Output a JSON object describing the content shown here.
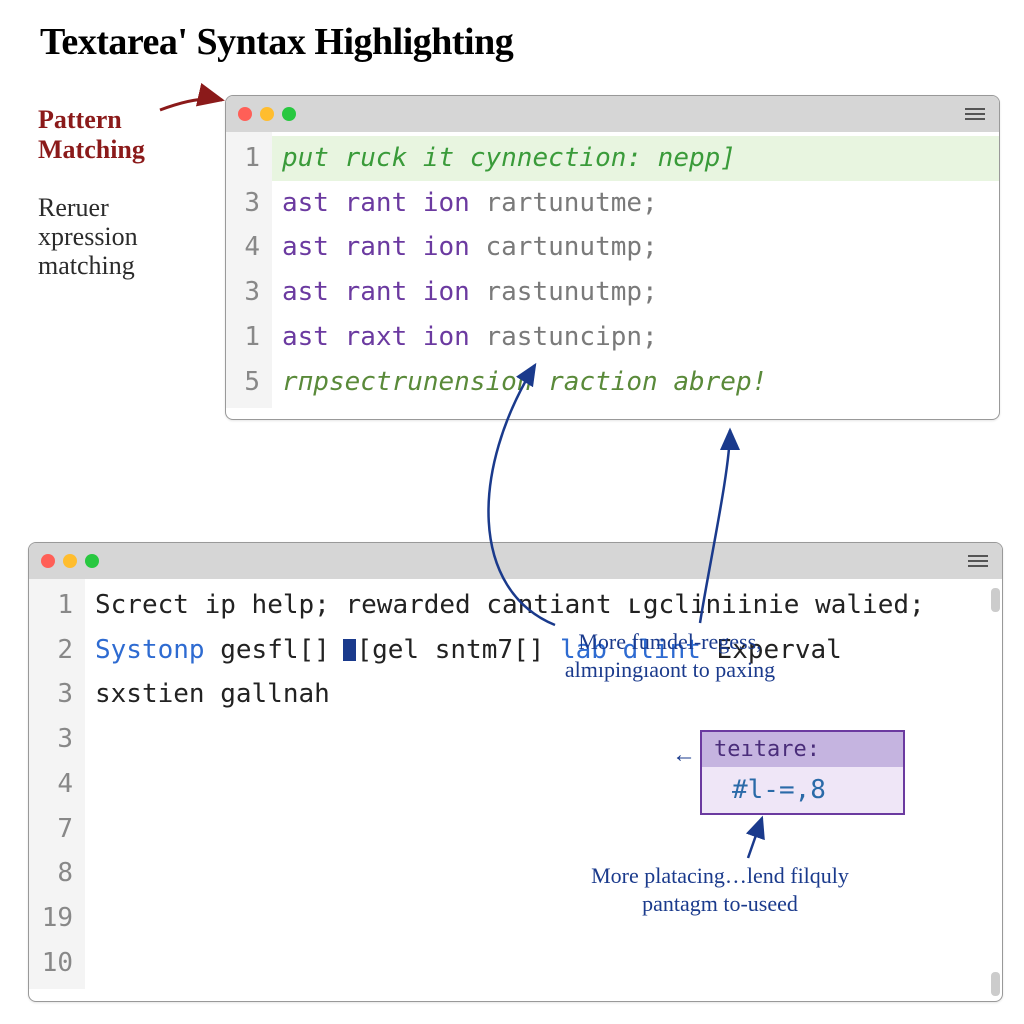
{
  "title": "Textarea' Syntax Highlighting",
  "labels": {
    "patternMatching": "Pattern\nMatching",
    "reruer": "Reruer\nxpression\nmatching"
  },
  "window1": {
    "gutter": [
      "1",
      "3",
      "4",
      "3",
      "1",
      "5"
    ],
    "line1": "put ruck it cynnection: nepp]",
    "line2_a": "ast rant ion",
    "line2_b": " rartunutme;",
    "line3_a": "ast rant ion",
    "line3_b": " cartunutmp;",
    "line4_a": "ast rant ion",
    "line4_b": " rastunutmp;",
    "line5_a": "ast raxt ion",
    "line5_b": " rastuncipn;",
    "line6_a": "rпpsectrunension",
    "line6_b": " raction abrep!"
  },
  "window2": {
    "gutter": [
      "1",
      "2",
      "3",
      "3",
      "4",
      "7",
      "8",
      "19",
      "10"
    ],
    "l1": "Screct ip",
    "l2": "help;",
    "l3": "rewarded cantiant",
    "l4_a": "ʟgcliniinie ",
    "l4_b": "walied;",
    "l5_a": "Systonp ",
    "l5_b": "gesfl[]",
    "l6_pre": "[",
    "l6_a": "gel sntm7",
    "l6_b": "[]",
    "l7_a": "lab ",
    "l7_b": "dlint",
    "l8": "Experval",
    "l9": "sxstien gallnah"
  },
  "annotations": {
    "a1": "More fumdel-regess,\nalmıpingıaont to paxing",
    "a2": "More platacing…lend filquly\npantagm to-useed"
  },
  "chip": {
    "header": "teıtare:",
    "body": "#l-=,8"
  }
}
